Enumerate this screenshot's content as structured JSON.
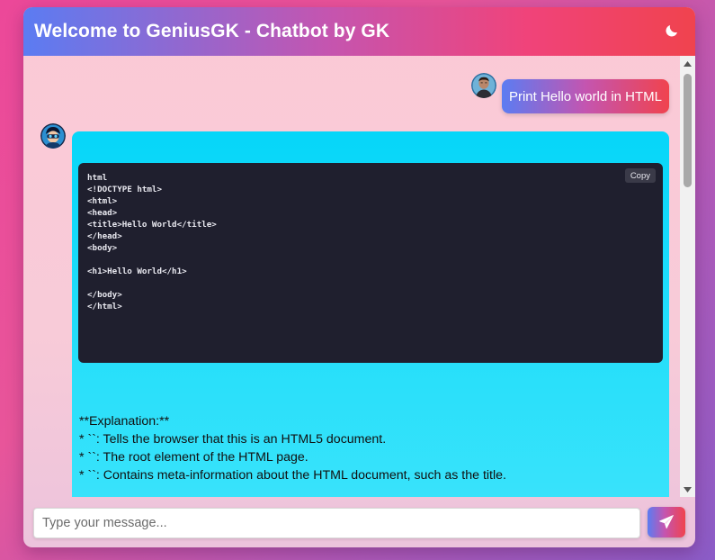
{
  "header": {
    "title": "Welcome to GeniusGK - Chatbot by GK",
    "theme_toggle_icon": "moon-icon"
  },
  "messages": [
    {
      "role": "user",
      "avatar_icon": "user-avatar",
      "text": "Print Hello world in HTML"
    },
    {
      "role": "bot",
      "avatar_icon": "bot-avatar",
      "code": {
        "copy_label": "Copy",
        "lines": [
          "html",
          "<!DOCTYPE html>",
          "<html>",
          "<head>",
          "<title>Hello World</title>",
          "</head>",
          "<body>",
          "",
          "<h1>Hello World</h1>",
          "",
          "</body>",
          "</html>"
        ]
      },
      "explanation": [
        "**Explanation:**",
        "",
        "* ``: Tells the browser that this is an HTML5 document.",
        "* ``: The root element of the HTML page.",
        "* ``: Contains meta-information about the HTML document, such as the title."
      ]
    }
  ],
  "composer": {
    "placeholder": "Type your message...",
    "value": "",
    "send_icon": "paper-plane-icon"
  },
  "colors": {
    "accent_start": "#5b7cf2",
    "accent_mid": "#c455b0",
    "accent_end": "#f0434e",
    "bot_bubble": "#06d6f9",
    "code_bg": "#1f1f2e"
  }
}
